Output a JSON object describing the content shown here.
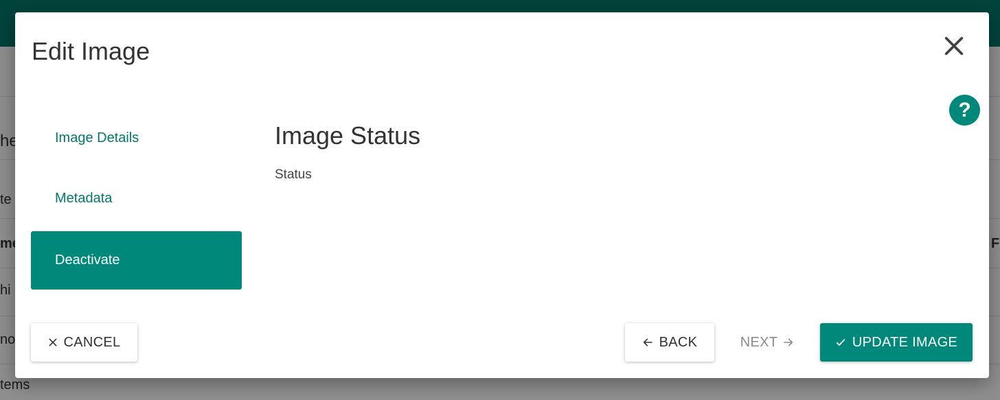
{
  "background": {
    "fragments": [
      "he",
      "te",
      "me",
      "hi",
      "no",
      "tems",
      "F"
    ]
  },
  "modal": {
    "title": "Edit Image"
  },
  "steps": [
    {
      "label": "Image Details"
    },
    {
      "label": "Metadata"
    },
    {
      "label": "Deactivate",
      "active": true
    }
  ],
  "content": {
    "section_title": "Image Status",
    "field_label": "Status"
  },
  "footer": {
    "cancel_label": "CANCEL",
    "back_label": "BACK",
    "next_label": "NEXT",
    "update_label": "UPDATE IMAGE"
  },
  "icons": {
    "close": "close-icon",
    "help": "help-icon",
    "cancel": "close-icon",
    "back": "arrow-left-icon",
    "next": "arrow-right-icon",
    "update": "check-icon"
  },
  "colors": {
    "accent": "#00897b",
    "header": "#00796b",
    "text": "#333333"
  }
}
